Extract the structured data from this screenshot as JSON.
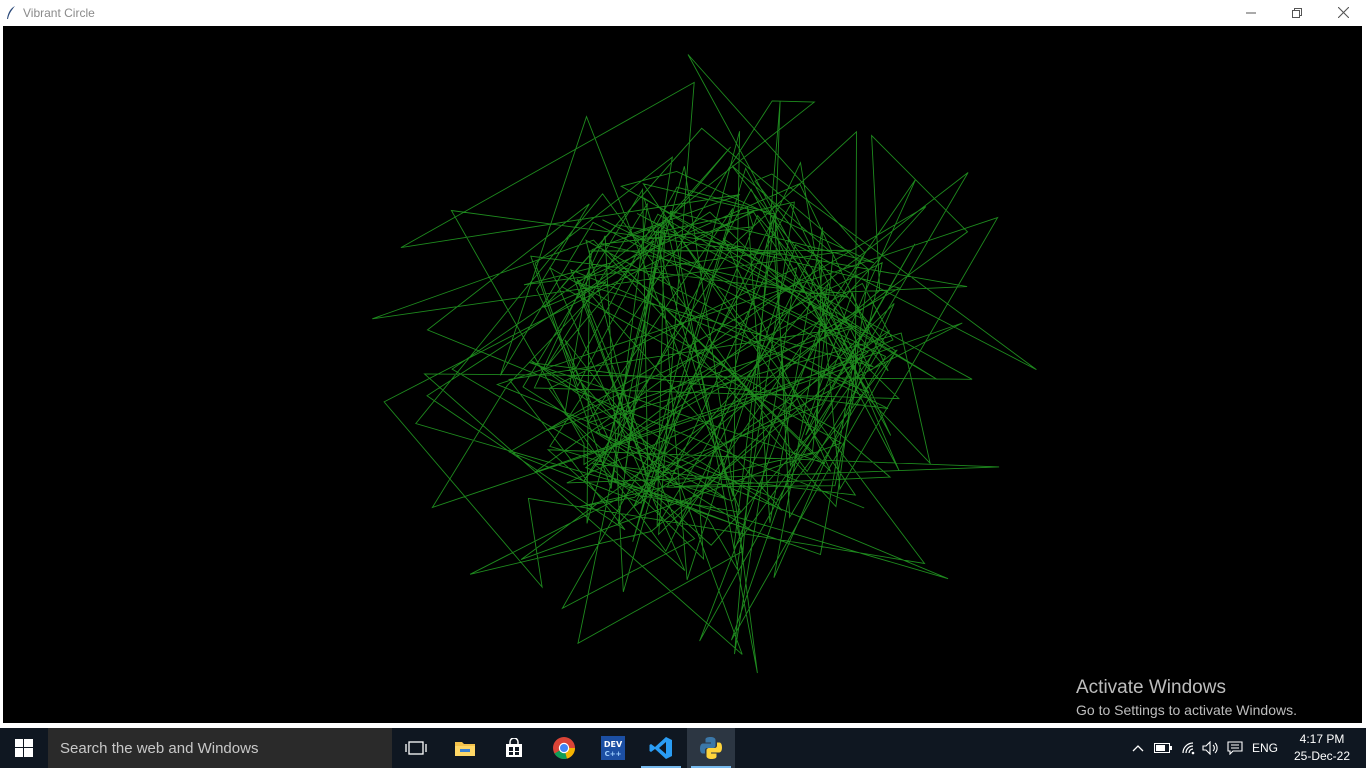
{
  "window": {
    "title": "Vibrant Circle",
    "controls": [
      "minimize",
      "restore",
      "close"
    ]
  },
  "canvas": {
    "background": "#000000",
    "stroke_color": "#1e8a1e",
    "figure": "random green line web star"
  },
  "watermark": {
    "title": "Activate Windows",
    "subtitle": "Go to Settings to activate Windows."
  },
  "taskbar": {
    "search_placeholder": "Search the web and Windows",
    "apps": [
      "task-view",
      "file-explorer",
      "store",
      "chrome",
      "devcpp",
      "vscode",
      "python"
    ],
    "active_app": "python",
    "language": "ENG",
    "time": "4:17 PM",
    "date": "25-Dec-22"
  },
  "colors": {
    "taskbar_bg": "#0f1721",
    "accent": "#76b9ed",
    "line_green": "#1e8a1e"
  }
}
